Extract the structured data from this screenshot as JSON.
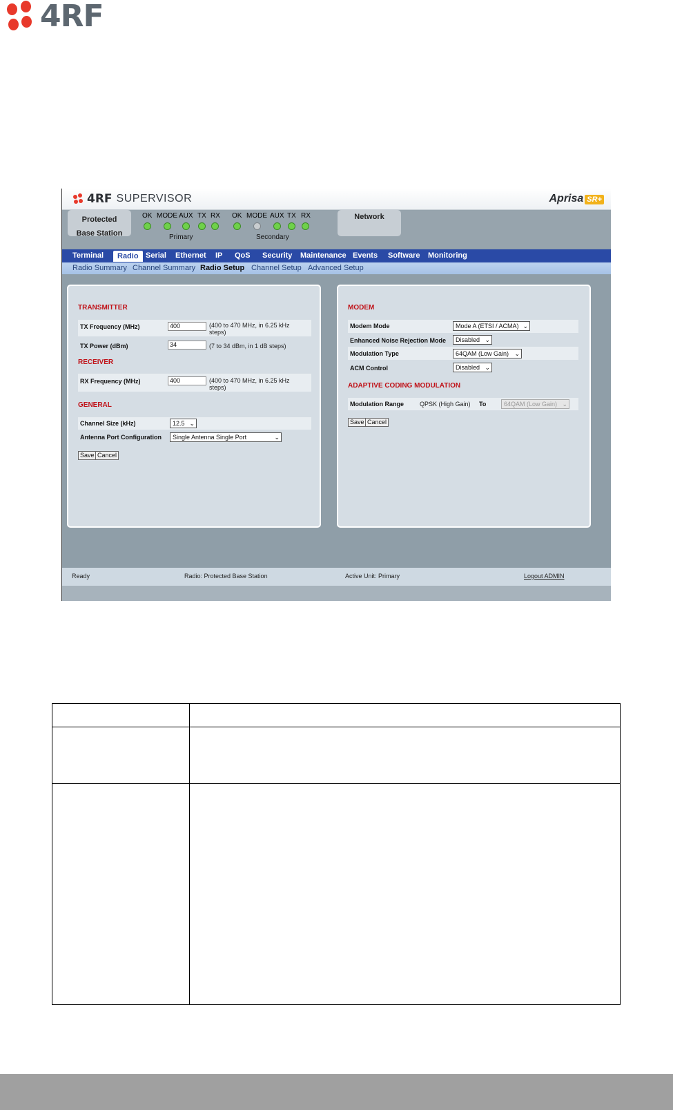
{
  "brand": {
    "logo_text": "4RF"
  },
  "supervisor": {
    "brand": "4RF",
    "title": "SUPERVISOR",
    "product": "Aprisa",
    "product_badge": "SR+"
  },
  "status": {
    "station_label": "Protected Base Station",
    "network_label": "Network",
    "primary_label": "Primary",
    "secondary_label": "Secondary",
    "primary_leds": [
      {
        "label": "OK",
        "state": "green"
      },
      {
        "label": "MODE",
        "state": "green"
      },
      {
        "label": "AUX",
        "state": "green"
      },
      {
        "label": "TX",
        "state": "green"
      },
      {
        "label": "RX",
        "state": "green"
      }
    ],
    "secondary_leds": [
      {
        "label": "OK",
        "state": "green"
      },
      {
        "label": "MODE",
        "state": "grey"
      },
      {
        "label": "AUX",
        "state": "green"
      },
      {
        "label": "TX",
        "state": "green"
      },
      {
        "label": "RX",
        "state": "green"
      }
    ]
  },
  "nav": {
    "items": [
      "Terminal",
      "Radio",
      "Serial",
      "Ethernet",
      "IP",
      "QoS",
      "Security",
      "Maintenance",
      "Events",
      "Software",
      "Monitoring"
    ],
    "active": "Radio"
  },
  "subnav": {
    "items": [
      "Radio Summary",
      "Channel Summary",
      "Radio Setup",
      "Channel Setup",
      "Advanced Setup"
    ],
    "active": "Radio Setup"
  },
  "left_panel": {
    "transmitter_title": "TRANSMITTER",
    "tx_freq_label": "TX Frequency (MHz)",
    "tx_freq_value": "400",
    "tx_freq_hint": "(400 to 470 MHz, in 6.25 kHz steps)",
    "tx_power_label": "TX Power (dBm)",
    "tx_power_value": "34",
    "tx_power_hint": "(7 to 34 dBm, in 1 dB steps)",
    "receiver_title": "RECEIVER",
    "rx_freq_label": "RX Frequency (MHz)",
    "rx_freq_value": "400",
    "rx_freq_hint": "(400 to 470 MHz, in 6.25 kHz steps)",
    "general_title": "GENERAL",
    "channel_size_label": "Channel Size (kHz)",
    "channel_size_value": "12.5",
    "antenna_label": "Antenna Port Configuration",
    "antenna_value": "Single Antenna Single Port",
    "save": "Save",
    "cancel": "Cancel"
  },
  "right_panel": {
    "modem_title": "MODEM",
    "modem_mode_label": "Modem Mode",
    "modem_mode_value": "Mode A (ETSI / ACMA)",
    "noise_label": "Enhanced Noise Rejection Mode",
    "noise_value": "Disabled",
    "mod_type_label": "Modulation Type",
    "mod_type_value": "64QAM (Low Gain)",
    "acm_label": "ACM Control",
    "acm_value": "Disabled",
    "acm_title": "ADAPTIVE CODING MODULATION",
    "mod_range_label": "Modulation Range",
    "mod_range_from": "QPSK (High Gain)",
    "mod_range_to_label": "To",
    "mod_range_to_value": "64QAM (Low Gain)",
    "save": "Save",
    "cancel": "Cancel"
  },
  "footer": {
    "status": "Ready",
    "radio": "Radio: Protected Base Station",
    "active_unit": "Active Unit: Primary",
    "logout": "Logout ADMIN"
  }
}
